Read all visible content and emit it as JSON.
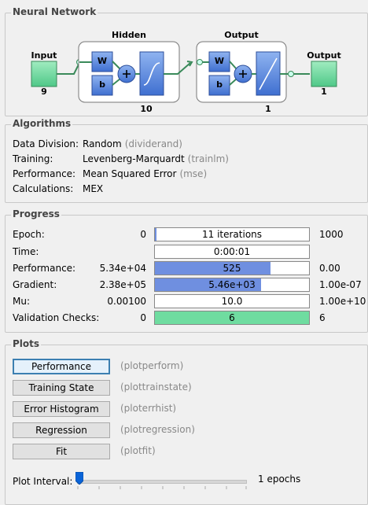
{
  "network": {
    "title": "Neural Network",
    "input": {
      "label": "Input",
      "size": "9"
    },
    "hidden": {
      "label": "Hidden",
      "size": "10",
      "weight_label": "W",
      "bias_label": "b"
    },
    "output_layer": {
      "label": "Output",
      "size": "1",
      "weight_label": "W",
      "bias_label": "b"
    },
    "output": {
      "label": "Output",
      "size": "1"
    }
  },
  "algorithms": {
    "title": "Algorithms",
    "rows": [
      {
        "key": "Data Division:",
        "value": "Random",
        "fn": "(dividerand)"
      },
      {
        "key": "Training:",
        "value": "Levenberg-Marquardt",
        "fn": "(trainlm)"
      },
      {
        "key": "Performance:",
        "value": "Mean Squared Error",
        "fn": "(mse)"
      },
      {
        "key": "Calculations:",
        "value": "MEX",
        "fn": ""
      }
    ]
  },
  "progress": {
    "title": "Progress",
    "rows": [
      {
        "label": "Epoch:",
        "start": "0",
        "bar_text": "11 iterations",
        "end": "1000",
        "fill": 0.011
      },
      {
        "label": "Time:",
        "start": "",
        "bar_text": "0:00:01",
        "end": "",
        "fill": 0
      },
      {
        "label": "Performance:",
        "start": "5.34e+04",
        "bar_text": "525",
        "end": "0.00",
        "fill": 0.75
      },
      {
        "label": "Gradient:",
        "start": "2.38e+05",
        "bar_text": "5.46e+03",
        "end": "1.00e-07",
        "fill": 0.69
      },
      {
        "label": "Mu:",
        "start": "0.00100",
        "bar_text": "10.0",
        "end": "1.00e+10",
        "fill": 0
      },
      {
        "label": "Validation Checks:",
        "start": "0",
        "bar_text": "6",
        "end": "6",
        "fill": 1.0
      }
    ]
  },
  "plots": {
    "title": "Plots",
    "buttons": [
      {
        "label": "Performance",
        "fn": "(plotperform)"
      },
      {
        "label": "Training State",
        "fn": "(plottrainstate)"
      },
      {
        "label": "Error Histogram",
        "fn": "(ploterrhist)"
      },
      {
        "label": "Regression",
        "fn": "(plotregression)"
      },
      {
        "label": "Fit",
        "fn": "(plotfit)"
      }
    ],
    "interval_label": "Plot Interval:",
    "interval_value": "1 epochs"
  },
  "colors": {
    "node_green": "#6fdca0",
    "layer_blue": "#5b8fe0",
    "progress_blue": "#6f8fe0",
    "progress_green": "#6fdca0"
  }
}
